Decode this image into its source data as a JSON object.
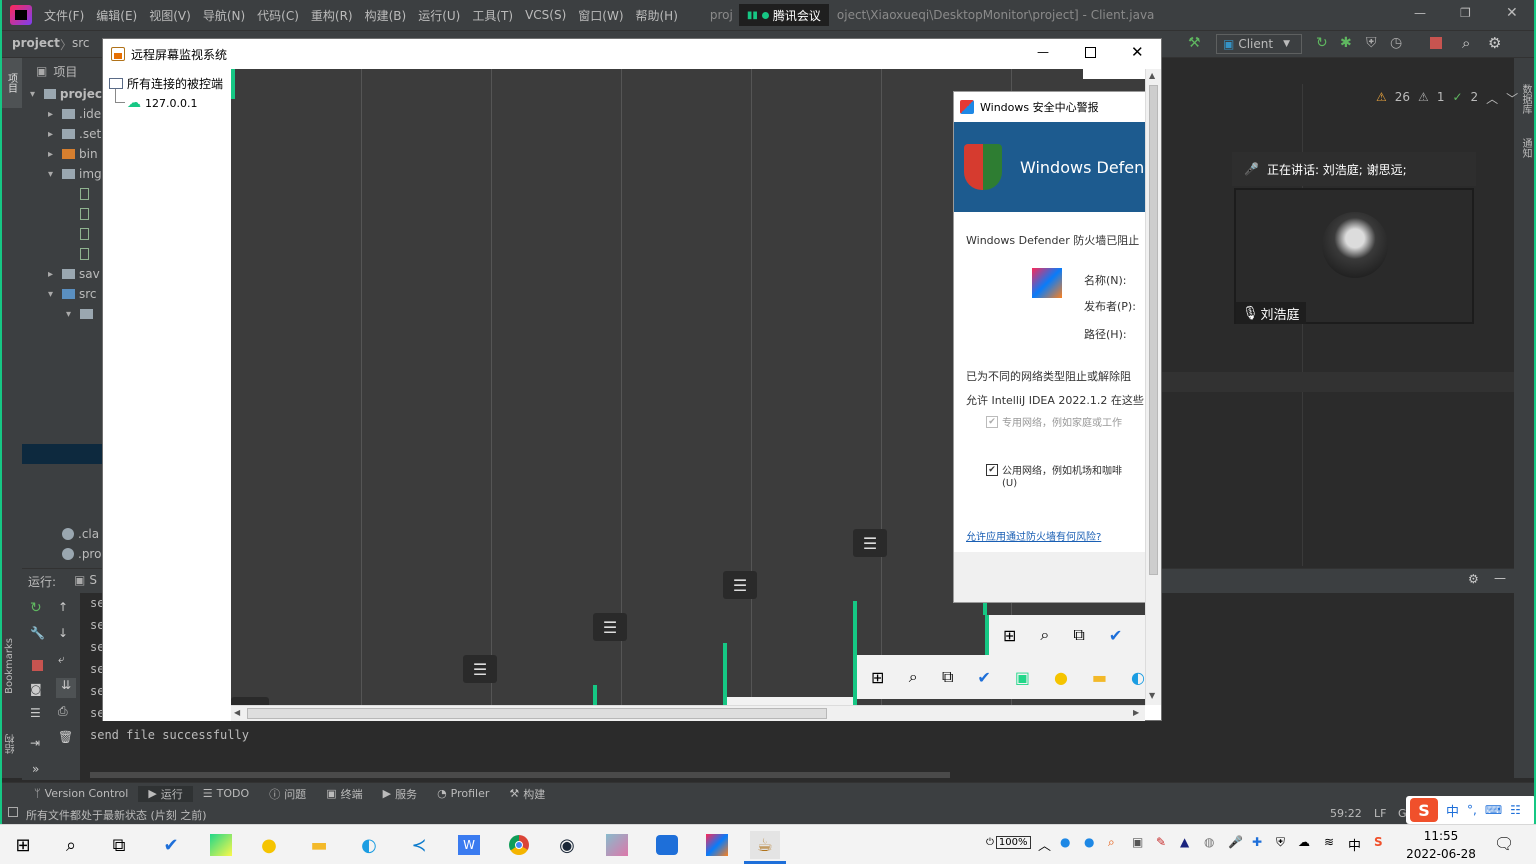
{
  "ide": {
    "menu": [
      "文件(F)",
      "编辑(E)",
      "视图(V)",
      "导航(N)",
      "代码(C)",
      "重构(R)",
      "构建(B)",
      "运行(U)",
      "工具(T)",
      "VCS(S)",
      "窗口(W)",
      "帮助(H)"
    ],
    "title_left": "proj",
    "meeting_tab": "腾讯会议",
    "title_right": "oject\\Xiaoxueqi\\DesktopMonitor\\project] - Client.java",
    "breadcrumb": [
      "project",
      "src"
    ],
    "run_config": "Client",
    "left_tool_project": "项目",
    "left_tool_bookmarks": "Bookmarks",
    "left_tool_structure": "结构",
    "right_tool_db": "数据库",
    "right_tool_notify": "通知",
    "project_header": "项目",
    "tree": [
      {
        "label": "projec",
        "indent": 0,
        "arrow": "▾",
        "icon": "folder-icon",
        "bold": true
      },
      {
        "label": ".ide",
        "indent": 1,
        "arrow": "▸",
        "icon": "folder-icon"
      },
      {
        "label": ".set",
        "indent": 1,
        "arrow": "▸",
        "icon": "folder-icon"
      },
      {
        "label": "bin",
        "indent": 1,
        "arrow": "▸",
        "icon": "folder-orange-icon"
      },
      {
        "label": "img",
        "indent": 1,
        "arrow": "▾",
        "icon": "folder-icon"
      },
      {
        "label": "",
        "indent": 2,
        "arrow": "",
        "icon": "file-icon"
      },
      {
        "label": "",
        "indent": 2,
        "arrow": "",
        "icon": "file-icon"
      },
      {
        "label": "",
        "indent": 2,
        "arrow": "",
        "icon": "file-icon"
      },
      {
        "label": "",
        "indent": 2,
        "arrow": "",
        "icon": "file-icon"
      },
      {
        "label": "sav",
        "indent": 1,
        "arrow": "▸",
        "icon": "folder-icon"
      },
      {
        "label": "src",
        "indent": 1,
        "arrow": "▾",
        "icon": "folder-blue-icon"
      },
      {
        "label": "",
        "indent": 2,
        "arrow": "▾",
        "icon": "package-icon"
      }
    ],
    "tree_bottom": [
      ".cla",
      ".pro"
    ],
    "inspections": {
      "warnings": "26",
      "weak": "1",
      "typos": "2"
    },
    "run_label": "运行:",
    "run_tab_prefix": "S",
    "console_lines": [
      "se",
      "se",
      "se",
      "se",
      "se",
      "se",
      "send file successfully"
    ],
    "bottom_tabs": [
      "Version Control",
      "运行",
      "TODO",
      "问题",
      "终端",
      "服务",
      "Profiler",
      "构建"
    ],
    "status_text": "所有文件都处于最新状态 (片刻 之前)",
    "status_right": {
      "pos": "59:22",
      "sep": "LF",
      "enc": "GI"
    }
  },
  "swing": {
    "title": "远程屏幕监视系统",
    "tree_root": "所有连接的被控端",
    "tree_child": "127.0.0.1"
  },
  "defender": {
    "title": "Windows 安全中心警报",
    "banner": "Windows Defenc",
    "heading": "Windows Defender 防火墙已阻止",
    "name_label": "名称(N):",
    "publisher_label": "发布者(P):",
    "path_label": "路径(H):",
    "desc1": "已为不同的网络类型阻止或解除阻",
    "desc2": "允许 IntelliJ IDEA 2022.1.2 在这些",
    "opt_private": "专用网络，例如家庭或工作",
    "opt_public": "公用网络，例如机场和咖啡",
    "opt_public_u": "(U)",
    "link": "允许应用通过防火墙有何风险?"
  },
  "meeting": {
    "speaking": "正在讲话: 刘浩庭; 谢思远;",
    "name": "刘浩庭"
  },
  "taskbar": {
    "battery": "100%",
    "ime": "中",
    "time": "11:55",
    "date": "2022-06-28"
  },
  "colors": {
    "accent_green": "#16c784",
    "ide_bg": "#2b2b2b",
    "ide_panel": "#3c3f41"
  }
}
